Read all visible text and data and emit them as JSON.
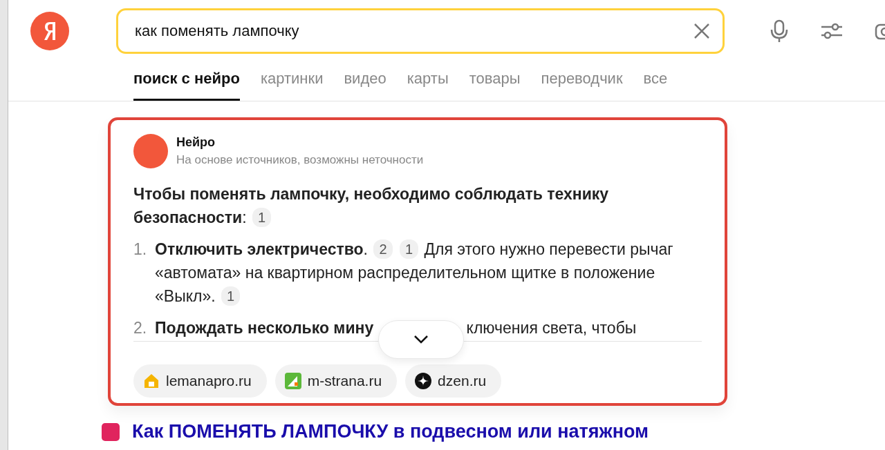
{
  "search": {
    "value": "как поменять лампочку"
  },
  "tabs": [
    {
      "label": "поиск с нейро",
      "selected": true
    },
    {
      "label": "картинки",
      "selected": false
    },
    {
      "label": "видео",
      "selected": false
    },
    {
      "label": "карты",
      "selected": false
    },
    {
      "label": "товары",
      "selected": false
    },
    {
      "label": "переводчик",
      "selected": false
    },
    {
      "label": "все",
      "selected": false
    }
  ],
  "neuro": {
    "name": "Нейро",
    "disclaimer": "На основе источников, возможны неточности",
    "intro": [
      {
        "kind": "text",
        "text": "**Чтобы поменять лампочку, необходимо соблюдать технику**"
      },
      {
        "kind": "text",
        "text": "**безопасности**:"
      },
      {
        "kind": "ref",
        "text": "1"
      }
    ],
    "steps": [
      {
        "number": "1.",
        "segments": [
          {
            "kind": "text",
            "text": "**Отключить электричество**."
          },
          {
            "kind": "ref",
            "text": "2"
          },
          {
            "kind": "ref",
            "text": "1"
          },
          {
            "kind": "text",
            "text": "Для этого нужно перевести рычаг"
          },
          {
            "kind": "text",
            "text": "«автомата» на квартирном распределительном щитке в положение"
          },
          {
            "kind": "text",
            "text": "«Выкл»."
          },
          {
            "kind": "ref",
            "text": "1"
          }
        ]
      },
      {
        "number": "2.",
        "segments": [
          {
            "kind": "text",
            "text": "**Подождать несколько мину**"
          },
          {
            "kind": "gap"
          },
          {
            "kind": "text",
            "text": "ключения света, чтобы"
          }
        ]
      }
    ],
    "sources": [
      {
        "kind": "house",
        "label": "lemanapro.ru"
      },
      {
        "kind": "garden",
        "label": "m-strana.ru"
      },
      {
        "kind": "star",
        "label": "dzen.ru"
      }
    ]
  },
  "result": {
    "title": "Как ПОМЕНЯТЬ ЛАМПОЧКУ в подвесном или натяжном"
  }
}
